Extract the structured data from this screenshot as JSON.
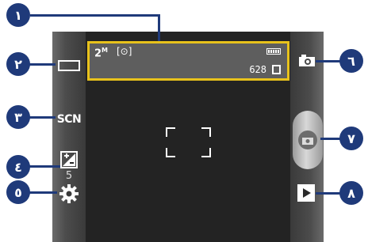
{
  "info_bar": {
    "resolution": "2",
    "resolution_unit": "M",
    "scene_indicator": "[⊙]",
    "shots_remaining": "628"
  },
  "left_controls": {
    "scene_label": "SCN",
    "exposure_value": "5"
  },
  "callouts": {
    "c1": "١",
    "c2": "٢",
    "c3": "٣",
    "c4": "٤",
    "c5": "٥",
    "c6": "٦",
    "c7": "٧",
    "c8": "٨"
  },
  "colors": {
    "callout": "#1f3a7a",
    "highlight": "#e8c21b"
  }
}
